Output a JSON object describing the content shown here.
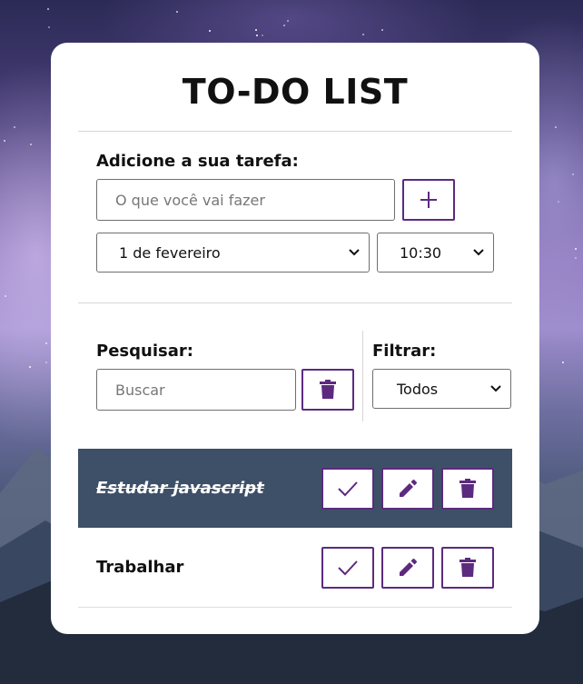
{
  "app": {
    "title": "TO-DO LIST"
  },
  "add_form": {
    "label": "Adicione a sua tarefa:",
    "task_placeholder": "O que você vai fazer",
    "add_button_icon": "plus-icon",
    "date_selected": "1 de fevereiro",
    "time_selected": "10:30"
  },
  "search": {
    "label": "Pesquisar:",
    "placeholder": "Buscar",
    "clear_button_icon": "trash-icon"
  },
  "filter": {
    "label": "Filtrar:",
    "selected": "Todos"
  },
  "todos": [
    {
      "title": "Estudar javascript",
      "done": true
    },
    {
      "title": "Trabalhar",
      "done": false
    }
  ],
  "colors": {
    "accent": "#5c2a7f",
    "done_row_bg": "#3e5068",
    "card_bg": "#ffffff"
  }
}
